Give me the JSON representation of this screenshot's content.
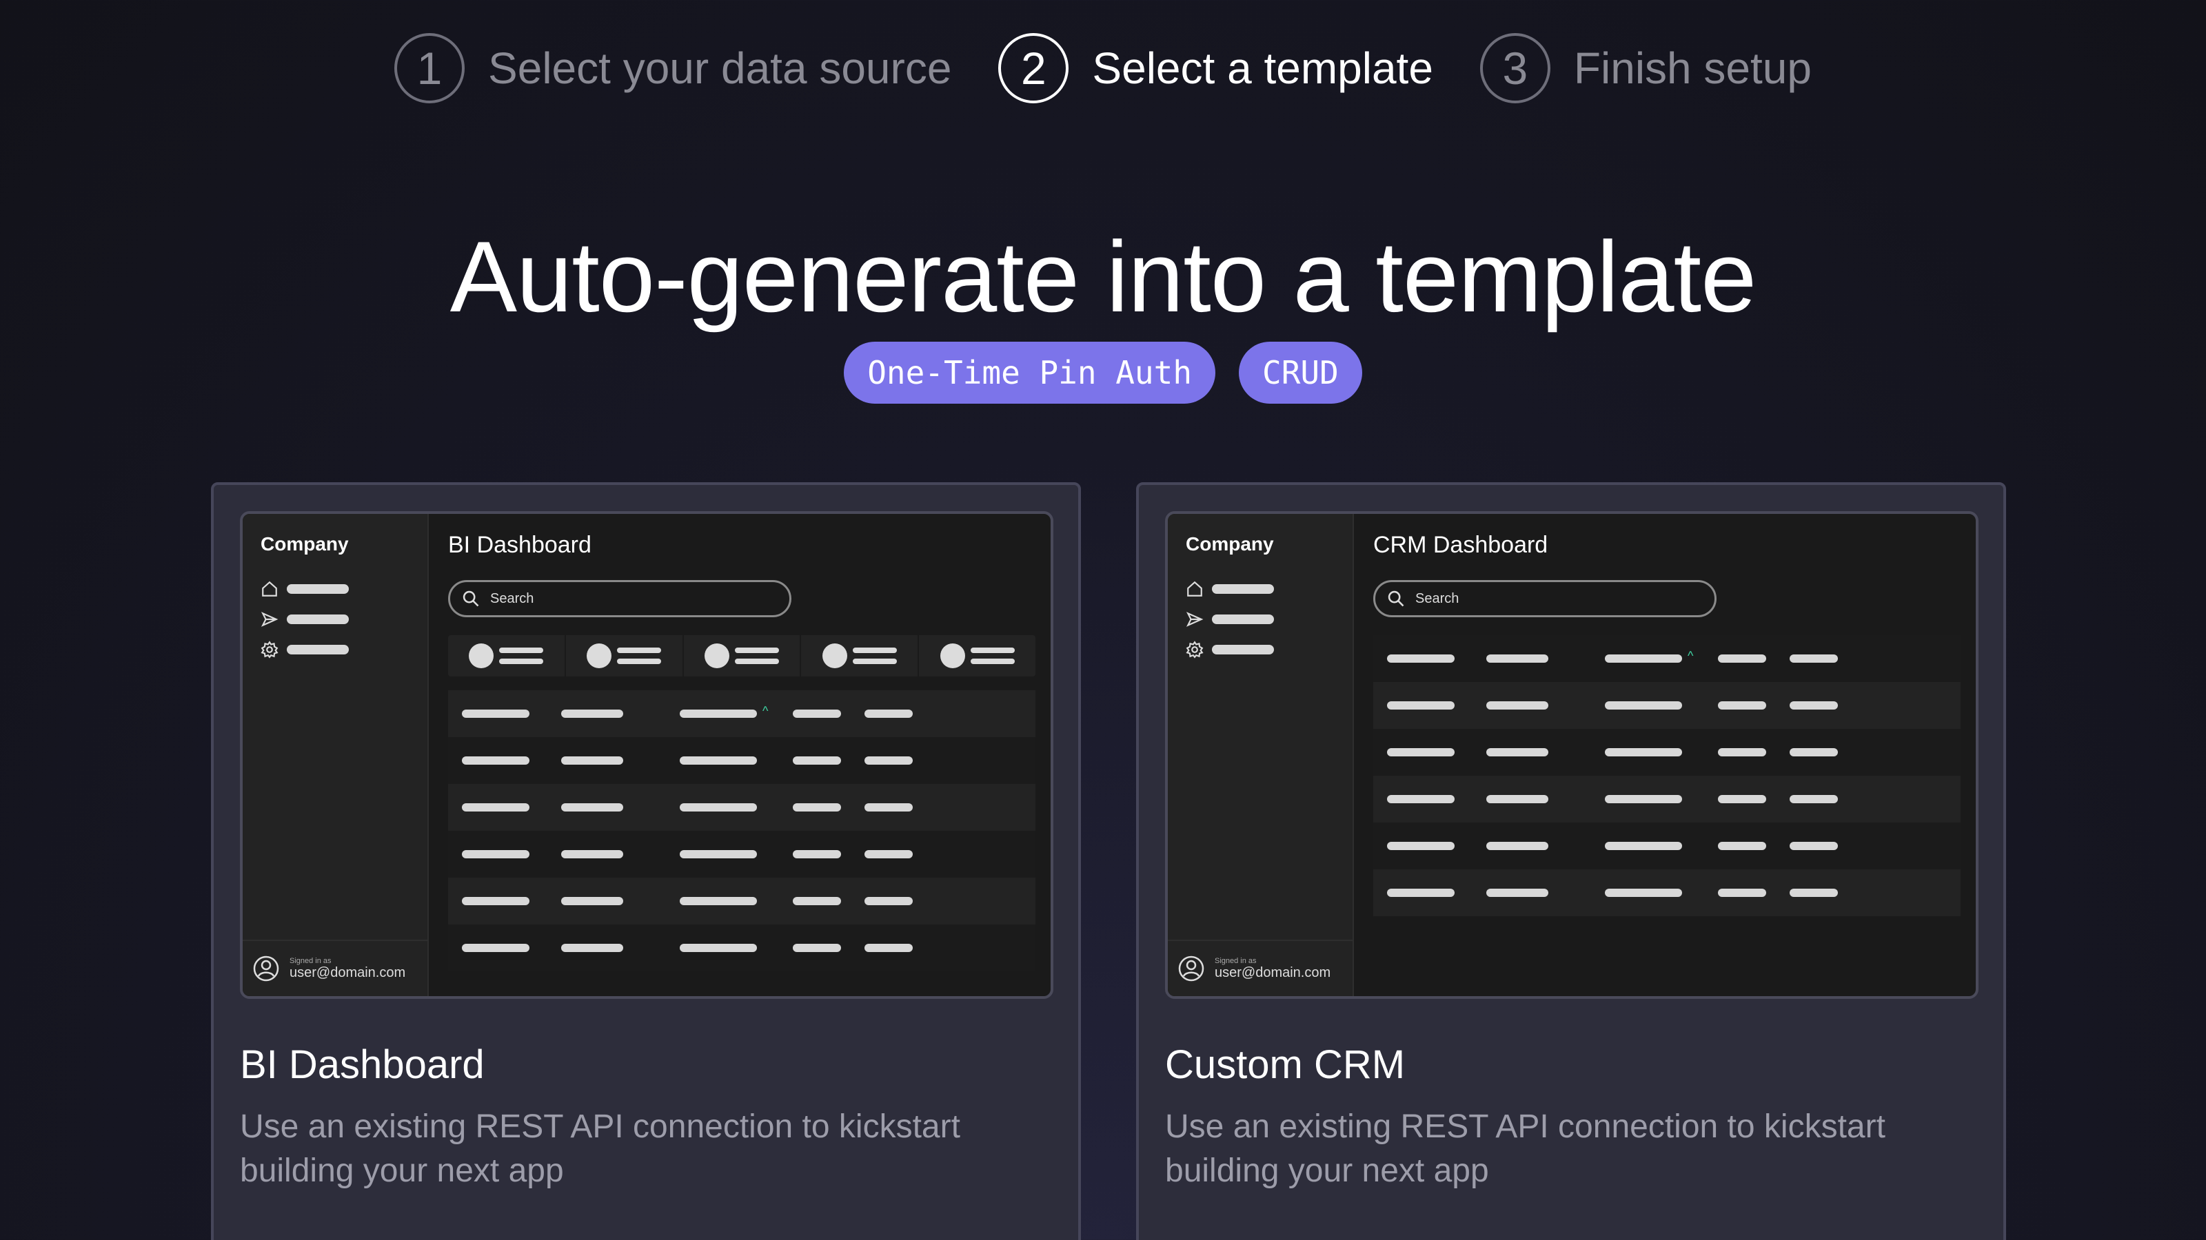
{
  "stepper": [
    {
      "number": "1",
      "label": "Select your data source",
      "active": false
    },
    {
      "number": "2",
      "label": "Select a template",
      "active": true
    },
    {
      "number": "3",
      "label": "Finish setup",
      "active": false
    }
  ],
  "headline": "Auto-generate into a template",
  "tags": [
    "One-Time Pin Auth",
    "CRUD"
  ],
  "cards": [
    {
      "preview": {
        "company": "Company",
        "dashboard_title": "BI Dashboard",
        "search_placeholder": "Search",
        "signed_in_label": "Signed in as",
        "user_email": "user@domain.com"
      },
      "title": "BI Dashboard",
      "description": "Use an existing REST API connection to kickstart building your next app"
    },
    {
      "preview": {
        "company": "Company",
        "dashboard_title": "CRM Dashboard",
        "search_placeholder": "Search",
        "signed_in_label": "Signed in as",
        "user_email": "user@domain.com"
      },
      "title": "Custom CRM",
      "description": "Use an existing REST API connection to kickstart building your next app"
    }
  ],
  "icons": [
    "home-icon",
    "send-icon",
    "gear-icon",
    "search-icon",
    "user-icon"
  ],
  "colors": {
    "accent": "#7c74ea",
    "sort_caret": "#3fd0a0"
  }
}
